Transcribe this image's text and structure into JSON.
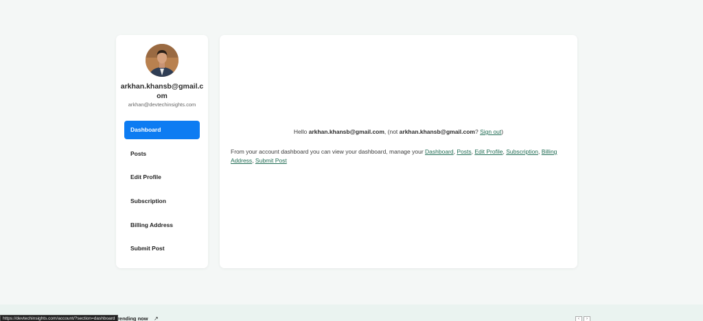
{
  "profile": {
    "username": "arkhan.khansb@gmail.com",
    "email": "arkhan@devtechinsights.com"
  },
  "menu": [
    {
      "label": "Dashboard",
      "active": true
    },
    {
      "label": "Posts",
      "active": false
    },
    {
      "label": "Edit Profile",
      "active": false
    },
    {
      "label": "Subscription",
      "active": false
    },
    {
      "label": "Billing Address",
      "active": false
    },
    {
      "label": "Submit Post",
      "active": false
    }
  ],
  "content": {
    "hello": "Hello ",
    "user": "arkhan.khansb@gmail.com",
    "not_prefix": ", (not ",
    "not_user": "arkhan.khansb@gmail.com",
    "question": "? ",
    "signout": "Sign out",
    "close_paren": ")",
    "desc_prefix": "From your account dashboard you can view your dashboard, manage your ",
    "links": [
      "Dashboard",
      "Posts",
      "Edit Profile",
      "Subscription",
      "Billing Address",
      "Submit Post"
    ]
  },
  "footer": {
    "status_url": "https://devtechinsights.com/account/?section=dashboard",
    "trending": "rending now",
    "arrow": "↗",
    "prev": "‹",
    "next": "›"
  },
  "colors": {
    "accent": "#0d7cf2",
    "link": "#1f6b52",
    "page_bg": "#f4f7f6"
  }
}
